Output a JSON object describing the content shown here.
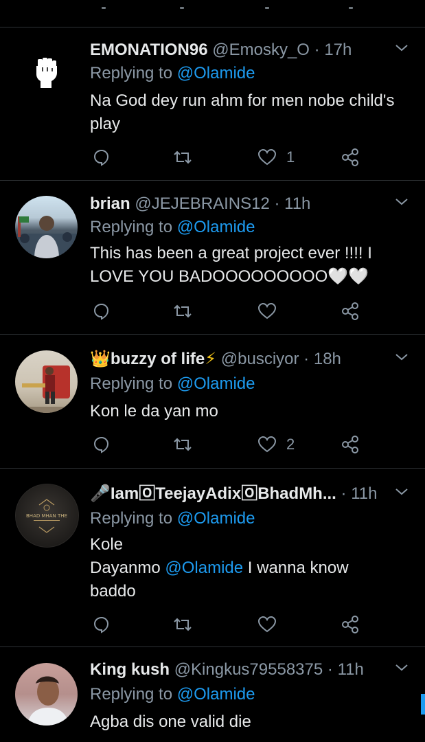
{
  "tweets": [
    {
      "name": "EMONATION96",
      "handle": "@Emosky_O",
      "sep": "·",
      "time": "17h",
      "replying_prefix": "Replying to ",
      "replying_to": "@Olamide",
      "text_lines": [
        "Na God dey run ahm for men nobe child's",
        "play"
      ],
      "likes": "1",
      "avatar_icon": "raised-fist-icon"
    },
    {
      "name": "brian",
      "handle": "@JEJEBRAINS12",
      "sep": "·",
      "time": "11h",
      "replying_prefix": "Replying to ",
      "replying_to": "@Olamide",
      "text_lines": [
        "This has been a great project ever !!!! I",
        "LOVE YOU BADOOOOOOOOO🤍🤍"
      ],
      "likes": ""
    },
    {
      "name_emoji": "👑",
      "name": "buzzy of life",
      "name_suffix": "⚡",
      "handle": "@busciyor",
      "sep": "·",
      "time": "18h",
      "replying_prefix": "Replying to ",
      "replying_to": "@Olamide",
      "text_lines": [
        "Kon le da yan mo"
      ],
      "likes": "2"
    },
    {
      "name_emoji": "🎤",
      "name": "Iam🄾TeejayAdix🄾BhadMh...",
      "handle": "",
      "sep": "·",
      "time": "11h",
      "replying_prefix": "Replying to ",
      "replying_to": "@Olamide",
      "text_lines": [
        "Kole",
        "Dayanmo ",
        "@Olamide",
        " I wanna know",
        "baddo"
      ],
      "likes": "",
      "avatar_text": "BHAD MHAN THE"
    },
    {
      "name": "King kush",
      "handle": "@Kingkus79558375",
      "sep": "·",
      "time": "11h",
      "replying_prefix": "Replying to ",
      "replying_to": "@Olamide",
      "text_lines": [
        "Agba dis one valid die"
      ],
      "likes": ""
    }
  ],
  "colors": {
    "background": "#000000",
    "text": "#e7e9ea",
    "secondary": "#8b98a5",
    "accent": "#1d9bf0",
    "divider": "#2f3336"
  }
}
